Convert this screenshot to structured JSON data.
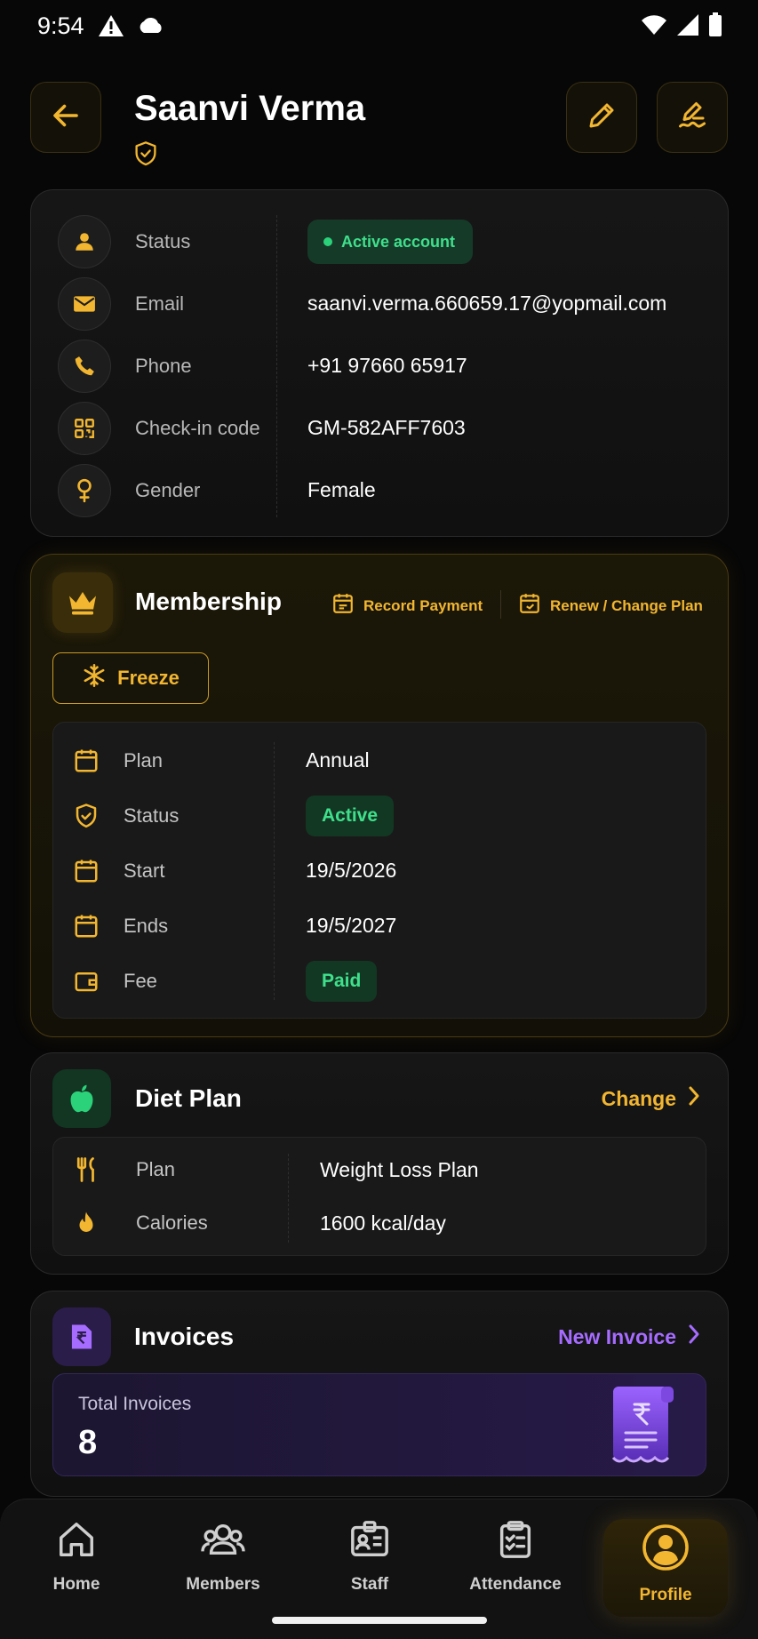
{
  "status_bar": {
    "time": "9:54"
  },
  "header": {
    "title": "Saanvi Verma"
  },
  "info": {
    "rows": [
      {
        "label": "Status",
        "value": "Active account"
      },
      {
        "label": "Email",
        "value": "saanvi.verma.660659.17@yopmail.com"
      },
      {
        "label": "Phone",
        "value": "+91 97660 65917"
      },
      {
        "label": "Check-in code",
        "value": "GM-582AFF7603"
      },
      {
        "label": "Gender",
        "value": "Female"
      }
    ]
  },
  "membership": {
    "title": "Membership",
    "record_payment": "Record Payment",
    "renew": "Renew / Change Plan",
    "freeze": "Freeze",
    "rows": [
      {
        "label": "Plan",
        "value": "Annual"
      },
      {
        "label": "Status",
        "value": "Active"
      },
      {
        "label": "Start",
        "value": "19/5/2026"
      },
      {
        "label": "Ends",
        "value": "19/5/2027"
      },
      {
        "label": "Fee",
        "value": "Paid"
      }
    ]
  },
  "diet": {
    "title": "Diet Plan",
    "change": "Change",
    "rows": [
      {
        "label": "Plan",
        "value": "Weight Loss Plan"
      },
      {
        "label": "Calories",
        "value": "1600 kcal/day"
      }
    ]
  },
  "invoices": {
    "title": "Invoices",
    "new_invoice": "New Invoice",
    "total_label": "Total Invoices",
    "total_value": "8"
  },
  "nav": {
    "items": [
      {
        "label": "Home",
        "icon": "home-icon"
      },
      {
        "label": "Members",
        "icon": "members-icon"
      },
      {
        "label": "Staff",
        "icon": "staff-id-icon"
      },
      {
        "label": "Attendance",
        "icon": "clipboard-check-icon"
      },
      {
        "label": "Profile",
        "icon": "profile-icon"
      }
    ],
    "active": "Profile"
  },
  "colors": {
    "accent": "#f2b630",
    "success": "#3fe08c",
    "purple": "#a66bff",
    "background": "#070707"
  }
}
